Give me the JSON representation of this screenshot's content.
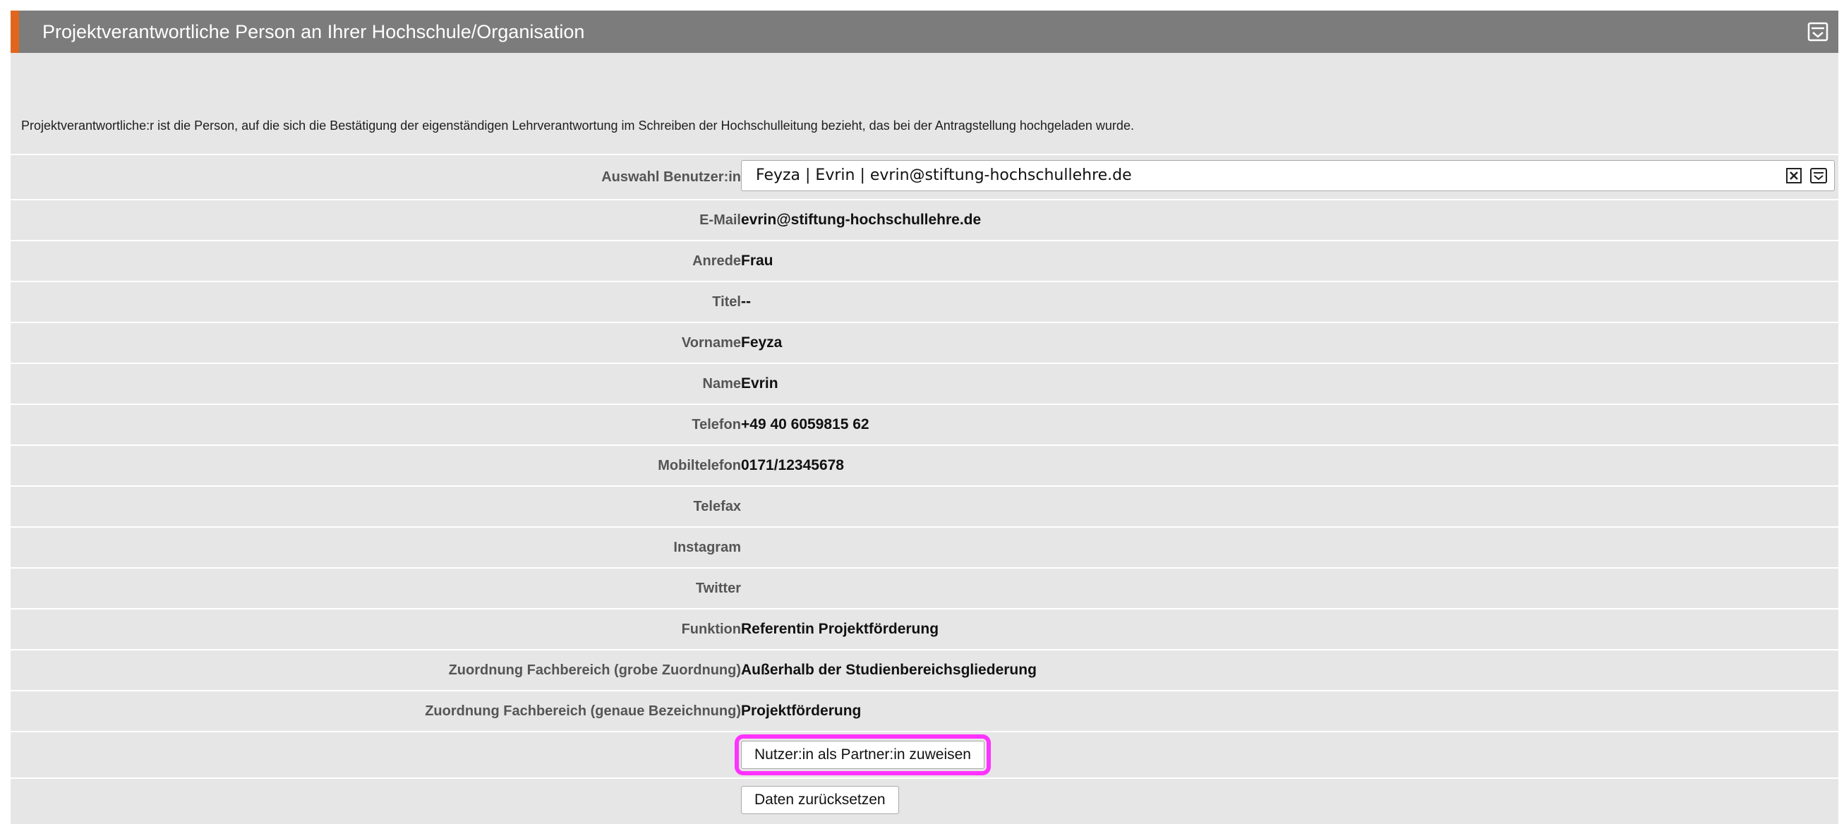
{
  "panel": {
    "title": "Projektverantwortliche Person an Ihrer Hochschule/Organisation",
    "intro": "Projektverantwortliche:r ist die Person, auf die sich die Bestätigung der eigenständigen Lehrverantwortung im Schreiben der Hochschulleitung bezieht, das bei der Antragstellung hochgeladen wurde."
  },
  "user_select": {
    "label": "Auswahl Benutzer:in",
    "value": "Feyza | Evrin | evrin@stiftung-hochschullehre.de"
  },
  "fields": [
    {
      "label": "E-Mail",
      "value": "evrin@stiftung-hochschullehre.de"
    },
    {
      "label": "Anrede",
      "value": "Frau"
    },
    {
      "label": "Titel",
      "value": "--"
    },
    {
      "label": "Vorname",
      "value": "Feyza"
    },
    {
      "label": "Name",
      "value": "Evrin"
    },
    {
      "label": "Telefon",
      "value": "+49 40 6059815 62"
    },
    {
      "label": "Mobiltelefon",
      "value": "0171/12345678"
    },
    {
      "label": "Telefax",
      "value": ""
    },
    {
      "label": "Instagram",
      "value": ""
    },
    {
      "label": "Twitter",
      "value": ""
    },
    {
      "label": "Funktion",
      "value": "Referentin Projektförderung"
    },
    {
      "label": "Zuordnung Fachbereich (grobe Zuordnung)",
      "value": "Außerhalb der Studienbereichsgliederung"
    },
    {
      "label": "Zuordnung Fachbereich (genaue Bezeichnung)",
      "value": "Projektförderung"
    }
  ],
  "buttons": {
    "assign_partner": "Nutzer:in als Partner:in zuweisen",
    "reset": "Daten zurücksetzen"
  },
  "colors": {
    "header_bg": "#7c7c7c",
    "header_accent": "#e0661e",
    "panel_bg": "#e6e6e6",
    "highlight": "#ff33ff"
  }
}
